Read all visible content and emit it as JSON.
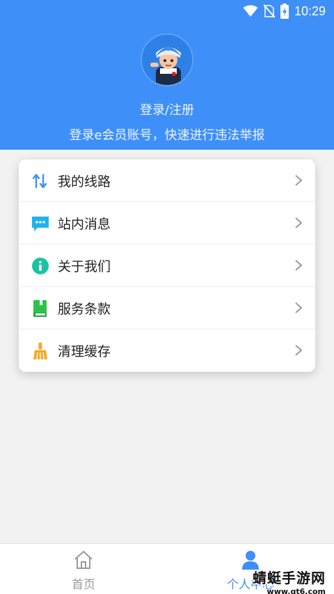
{
  "status_bar": {
    "time": "10:29",
    "icons": [
      "wifi-icon",
      "no-sim-icon",
      "battery-charging-icon"
    ]
  },
  "header": {
    "login_label": "登录/注册",
    "subtitle": "登录e会员账号，快速进行违法举报",
    "accent_color": "#3e8ff7"
  },
  "menu": {
    "items": [
      {
        "label": "我的线路",
        "icon": "route-arrows-icon"
      },
      {
        "label": "站内消息",
        "icon": "message-icon"
      },
      {
        "label": "关于我们",
        "icon": "info-icon"
      },
      {
        "label": "服务条款",
        "icon": "book-icon"
      },
      {
        "label": "清理缓存",
        "icon": "broom-icon"
      }
    ]
  },
  "tabbar": {
    "tabs": [
      {
        "label": "首页",
        "icon": "home-icon",
        "active": false
      },
      {
        "label": "个人中心",
        "icon": "person-icon",
        "active": true
      }
    ]
  },
  "watermark": {
    "title": "蜻蜓手游网",
    "url": "www.qt6.com"
  }
}
